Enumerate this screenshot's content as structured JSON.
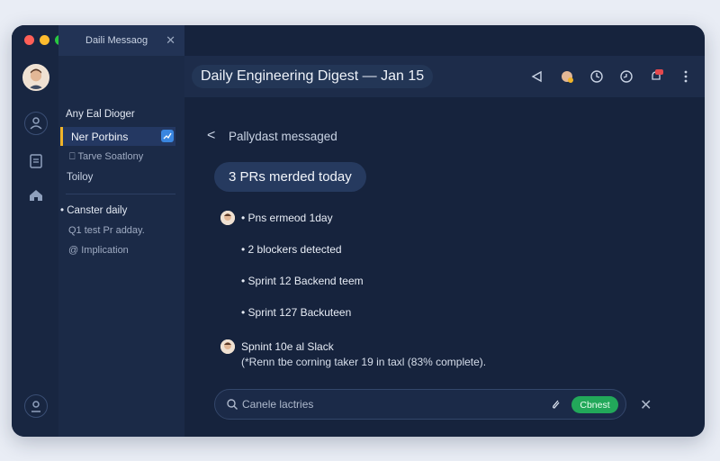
{
  "window": {
    "tab_title": "Daili Messaog",
    "tab_close": "✕"
  },
  "rail": {
    "icons": [
      "team-icon",
      "notes-icon",
      "home-icon",
      "profile-icon"
    ]
  },
  "sidebar": {
    "title": "Any Eal Dioger",
    "active_item": "Ner Porbins",
    "items": [
      {
        "label": "Tarve Soatlony",
        "prefix": "⎕"
      },
      {
        "label": "Toiloy",
        "prefix": ""
      },
      {
        "label": "Canster daily",
        "prefix": "•"
      },
      {
        "label": "Q1 test Pr adday.",
        "prefix": ""
      },
      {
        "label": "@ Implication",
        "prefix": ""
      }
    ]
  },
  "header": {
    "title": "Daily Engineering Digest — Jan 15",
    "icons": [
      "share-icon",
      "user-status-icon",
      "clock-icon",
      "history-icon",
      "notification-icon",
      "more-icon"
    ]
  },
  "thread": {
    "back_label": "<",
    "subhead": "Pallydast messaged",
    "summary": "3 PRs merded today",
    "lines": [
      "• Pns ermeod 1day",
      "• 2 blockers detected",
      "• Sprint 12 Backend teem",
      "• Sprint 127 Backuteen",
      "Spnint 10e al Slack",
      "(*Renn tbe corning taker 19 in taxl (83% complete)."
    ]
  },
  "composer": {
    "placeholder": "Canele lactries",
    "send_label": "Cbnest",
    "close_label": "✕"
  },
  "colors": {
    "accent_yellow": "#f0b429",
    "send_green": "#22a85a",
    "notification_red": "#e5484d"
  }
}
